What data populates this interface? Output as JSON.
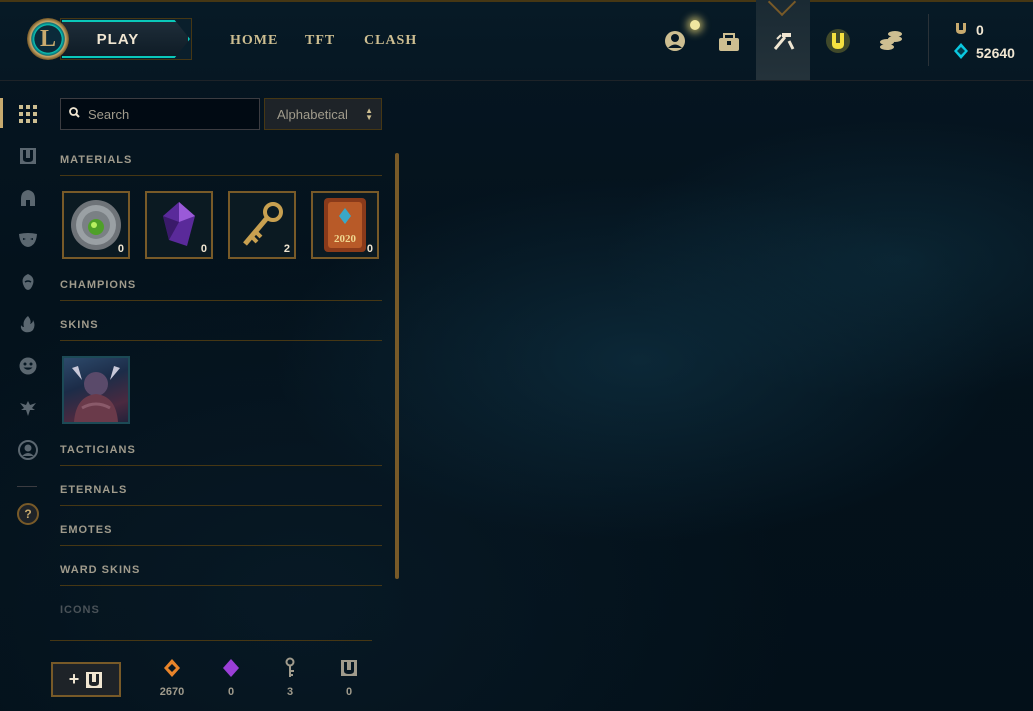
{
  "topnav": {
    "play_label": "PLAY",
    "links": [
      "HOME",
      "TFT",
      "CLASH"
    ],
    "icons": [
      "profile-icon",
      "collection-icon",
      "loot-icon",
      "ranked-icon",
      "store-icon"
    ]
  },
  "wallet": {
    "rp": "0",
    "blue_essence": "52640"
  },
  "sidebar": {
    "icons": [
      "grid-icon",
      "chest-icon",
      "helmet-icon",
      "mask-icon",
      "champion-shard-icon",
      "flame-icon",
      "emote-icon",
      "ward-icon",
      "profile-icon"
    ],
    "help_label": "?"
  },
  "toolbar": {
    "search_placeholder": "Search",
    "sort_value": "Alphabetical"
  },
  "sections": {
    "materials": "MATERIALS",
    "champions": "CHAMPIONS",
    "skins": "SKINS",
    "tacticians": "TACTICIANS",
    "eternals": "ETERNALS",
    "emotes": "EMOTES",
    "ward_skins": "WARD SKINS",
    "icons": "ICONS"
  },
  "materials": [
    {
      "name": "orb",
      "count": "0"
    },
    {
      "name": "gemstone",
      "count": "0"
    },
    {
      "name": "key",
      "count": "2"
    },
    {
      "name": "event-token-2020",
      "count": "0",
      "label": "2020"
    }
  ],
  "footer": {
    "craft_label": "+",
    "currencies": [
      {
        "name": "orange-essence",
        "value": "2670",
        "color": "#e8842a"
      },
      {
        "name": "mythic-gem",
        "value": "0",
        "color": "#9b3fd8"
      },
      {
        "name": "key-fragment",
        "value": "3",
        "color": "#a09b8c"
      },
      {
        "name": "chest",
        "value": "0",
        "color": "#a09b8c"
      }
    ]
  },
  "colors": {
    "gold": "#c8aa6e",
    "gold_dark": "#785a28",
    "teal": "#0ac8b9",
    "text": "#a09b8c"
  }
}
